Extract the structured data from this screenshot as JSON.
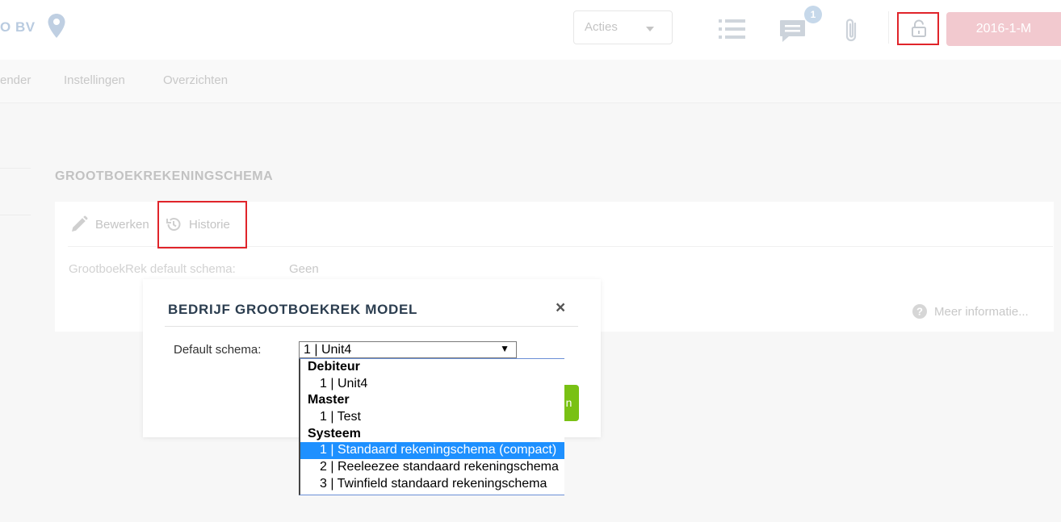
{
  "header": {
    "company": "O BV",
    "actions_label": "Acties",
    "chat_badge": "1",
    "period_label": "2016-1-M"
  },
  "nav": {
    "items": [
      "ender",
      "Instellingen",
      "Overzichten"
    ]
  },
  "section": {
    "title": "GROOTBOEKREKENINGSCHEMA",
    "edit_label": "Bewerken",
    "history_label": "Historie",
    "field_label": "GrootboekRek default schema:",
    "field_value": "Geen",
    "help_label": "Meer informatie..."
  },
  "modal": {
    "title": "BEDRIJF GROOTBOEKREK MODEL",
    "close": "×",
    "schema_label": "Default schema:",
    "selected_value": "1 | Unit4",
    "save_fragment": "n"
  },
  "dropdown": {
    "groups": [
      {
        "label": "Debiteur",
        "options": [
          "1 | Unit4"
        ]
      },
      {
        "label": "Master",
        "options": [
          "1 | Test"
        ]
      },
      {
        "label": "Systeem",
        "options": [
          "1 | Standaard rekeningschema (compact)",
          "2 | Reeleezee standaard rekeningschema",
          "3 | Twinfield standaard rekeningschema"
        ]
      }
    ],
    "highlighted": "1 | Standaard rekeningschema (compact)"
  },
  "colors": {
    "highlight": "#e0242a",
    "selected_option": "#1e90ff",
    "save_button": "#79c114",
    "period_button": "#f2c9cf"
  },
  "icons": [
    "location-pin-icon",
    "caret-down-icon",
    "list-icon",
    "chat-icon",
    "paperclip-icon",
    "lock-icon",
    "pencil-icon",
    "history-icon",
    "help-icon",
    "close-icon"
  ]
}
